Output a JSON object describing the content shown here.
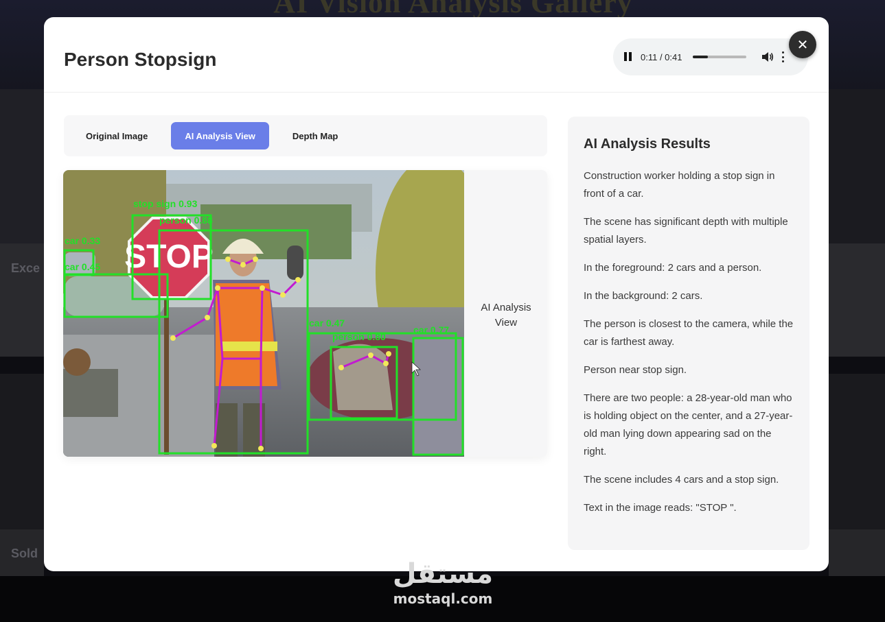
{
  "background": {
    "gallery_title": "AI Vision Analysis Gallery",
    "card_labels": [
      "Exce",
      "Sold"
    ]
  },
  "modal": {
    "title": "Person Stopsign",
    "close_glyph": "✕"
  },
  "audio_player": {
    "time": "0:11 / 0:41",
    "progress_fraction": 0.27
  },
  "tabs": [
    {
      "label": "Original Image",
      "active": false
    },
    {
      "label": "AI Analysis View",
      "active": true
    },
    {
      "label": "Depth Map",
      "active": false
    }
  ],
  "image_view": {
    "caption": "AI Analysis View",
    "sign_text": "STOP",
    "detections": [
      {
        "label": "stop sign 0.93"
      },
      {
        "label": "person 0.88"
      },
      {
        "label": "car 0.33"
      },
      {
        "label": "car 0.45"
      },
      {
        "label": "car 0.47"
      },
      {
        "label": "person 0.80"
      },
      {
        "label": "car 0.77"
      }
    ]
  },
  "results": {
    "title": "AI Analysis Results",
    "items": [
      "Construction worker holding a stop sign in front of a car.",
      "The scene has significant depth with multiple spatial layers.",
      "In the foreground: 2 cars and a person.",
      "In the background: 2 cars.",
      "The person is closest to the camera, while the car is farthest away.",
      "Person near stop sign.",
      "There are two people: a 28-year-old man who is holding object on the center, and a 27-year-old man lying down appearing sad on the right.",
      "The scene includes 4 cars and a stop sign.",
      "Text in the image reads: \"STOP \"."
    ]
  },
  "watermark": {
    "arabic": "مستقل",
    "latin": "mostaql.com"
  },
  "colors": {
    "active_tab": "#6a7ee8",
    "detection_box": "#22e028",
    "skeleton": "#c21bd0",
    "keypoint": "#f2e85a"
  },
  "icons": [
    "pause-icon",
    "volume-icon",
    "more-vertical-icon",
    "close-icon"
  ]
}
